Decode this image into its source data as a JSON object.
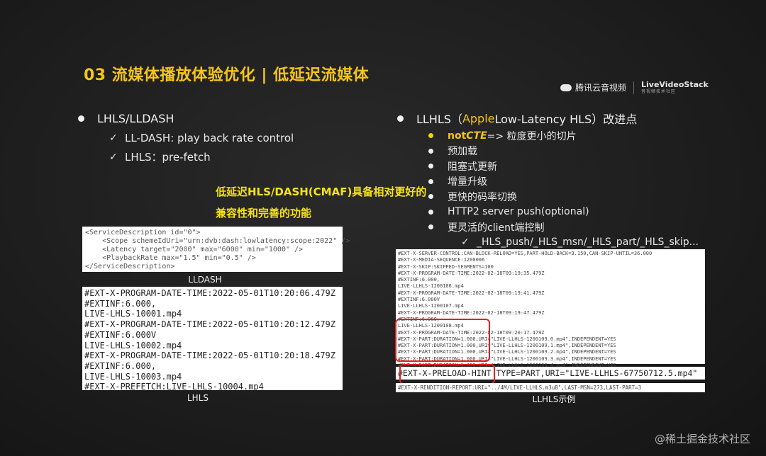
{
  "title": "03 流媒体播放体验优化 | 低延迟流媒体",
  "logo": {
    "tencent": "腾讯云音视频",
    "lvs": "LiveVideoStack",
    "lvs_sub": "音视频技术社区"
  },
  "left": {
    "heading": "LHLS/LLDASH",
    "items": [
      "LL-DASH: play back rate control",
      "LHLS：pre-fetch"
    ]
  },
  "highlight": "低延迟HLS/DASH(CMAF)具备相对更好的兼容性和完善的功能",
  "lldash": {
    "caption": "LLDASH",
    "code": "<ServiceDescription id=\"0\">\n    <Scope schemeIdUri=\"urn:dvb:dash:lowlatency:scope:2022\" />\n    <Latency target=\"2000\" max=\"6000\" min=\"1000\" />\n    <PlaybackRate max=\"1.5\" min=\"0.5\" />\n</ServiceDescription>"
  },
  "lhls": {
    "caption": "LHLS",
    "code": "#EXT-X-PROGRAM-DATE-TIME:2022-05-01T10:20:06.479Z\n#EXTINF:6.000,\nLIVE-LHLS-10001.mp4\n#EXT-X-PROGRAM-DATE-TIME:2022-05-01T10:20:12.479Z\n#EXTINF:6.000V\nLIVE-LHLS-10002.mp4\n#EXT-X-PROGRAM-DATE-TIME:2022-05-01T10:20:18.479Z\n#EXTINF:6.000,\nLIVE-LHLS-10003.mp4\n#EXT-X-PREFETCH:LIVE-LHLS-10004.mp4"
  },
  "right": {
    "heading_pre": "LLHLS（",
    "heading_apple": "Apple",
    "heading_post": " Low-Latency HLS）改进点",
    "first_item_a": "not ",
    "first_item_b": "CTE",
    "first_item_c": " => 粒度更小的切片",
    "items": [
      "预加载",
      "阻塞式更新",
      "增量升级",
      "更快的码率切换",
      "HTTP2 server push(optional)",
      "更灵活的client端控制"
    ],
    "sub_item": "_HLS_push/_HLS_msn/_HLS_part/_HLS_skip..."
  },
  "llhls": {
    "caption": "LLHLS示例",
    "code": "#EXT-X-SERVER-CONTROL:CAN-BLOCK-RELOAD=YES,PART-HOLD-BACK=3.150,CAN-SKIP-UNTIL=36.000\n#EXT-X-MEDIA-SEQUENCE:1200006\n#EXT-X-SKIP:SKIPPED-SEGMENTS=100\n#EXT-X-PROGRAM-DATE-TIME:2022-02-18T09:19:35.479Z\n#EXTINF:6.000,\nLIVE-LLHLS-1200106.mp4\n#EXT-X-PROGRAM-DATE-TIME:2022-02-18T09:19:41.479Z\n#EXTINF:6.000V\nLIVE-LLHLS-1200107.mp4\n#EXT-X-PROGRAM-DATE-TIME:2022-02-18T09:19:47.479Z\n#EXTINF:6.000,\nLIVE-LLHLS-1200108.mp4\n#EXT-X-PROGRAM-DATE-TIME:2022-02-18T09:20:17.479Z\n#EXT-X-PART:DURATION=1.000,URI=\"LIVE-LLHLS-1200109.0.mp4\",INDEPENDENT=YES\n#EXT-X-PART:DURATION=1.000,URI=\"LIVE-LLHLS-1200109.1.mp4\",INDEPENDENT=YES\n#EXT-X-PART:DURATION=1.000,URI=\"LIVE-LLHLS-1200109.2.mp4\",INDEPENDENT=YES\n#EXT-X-PART:DURATION=1.000,URI=\"LIVE-LLHLS-1200109.3.mp4\",INDEPENDENT=YES\n#EXT-X-PART:DURATION=1.000,URI=\"LIVE-LLHLS-1200109.4.mp4\",INDEPENDENT=YES\n#EXT-X-PART:DURATION=1.000,URI=\"LIVE-LLHLS-1200109.5.mp4\",INDEPENDENT=YES",
    "preload": "#EXT-X-PRELOAD-HINT TYPE=PART,URI=\"LIVE-LLHLS-67750712.5.mp4\"",
    "rendition": "#EXT-X-RENDITION-REPORT:URI=\"../4M/LIVE-LLHLS.m3u8\",LAST-MSN=273,LAST-PART=3"
  },
  "watermark": "@稀土掘金技术社区",
  "colors": {
    "accent": "#f5c518",
    "highlight": "#f5e218",
    "red_box": "#e02020"
  }
}
